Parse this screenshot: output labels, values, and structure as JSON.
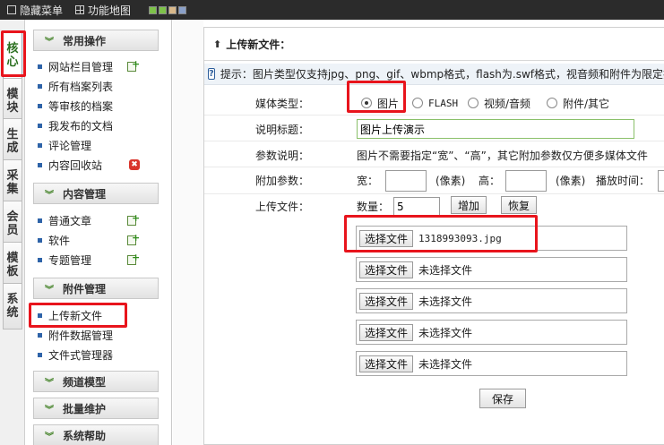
{
  "topbar": {
    "hide_menu": "隐藏菜单",
    "func_map": "功能地图",
    "swatches": [
      "#7ec24a",
      "#7ec24a",
      "#d8b88a",
      "#8aa0c8"
    ]
  },
  "vtabs": [
    {
      "line1": "核",
      "line2": "心"
    },
    {
      "line1": "模",
      "line2": "块"
    },
    {
      "line1": "生",
      "line2": "成"
    },
    {
      "line1": "采",
      "line2": "集"
    },
    {
      "line1": "会",
      "line2": "员"
    },
    {
      "line1": "模",
      "line2": "板"
    },
    {
      "line1": "系",
      "line2": "统"
    }
  ],
  "menu": {
    "common": {
      "title": "常用操作",
      "items": [
        "网站栏目管理",
        "所有档案列表",
        "等审核的档案",
        "我发布的文档",
        "评论管理",
        "内容回收站"
      ]
    },
    "content": {
      "title": "内容管理",
      "items": [
        "普通文章",
        "软件",
        "专题管理"
      ]
    },
    "attach": {
      "title": "附件管理",
      "items": [
        "上传新文件",
        "附件数据管理",
        "文件式管理器"
      ]
    },
    "channel": {
      "title": "频道模型"
    },
    "batch": {
      "title": "批量维护"
    },
    "help": {
      "title": "系统帮助"
    }
  },
  "main": {
    "title": "上传新文件：",
    "tip": "提示：图片类型仅支持jpg、png、gif、wbmp格式，flash为.swf格式，视音频和附件为限定扩",
    "media_label": "媒体类型：",
    "media_options": [
      "图片",
      "FLASH",
      "视频/音频",
      "附件/其它"
    ],
    "caption_label": "说明标题：",
    "caption_value": "图片上传演示",
    "param_label": "参数说明：",
    "param_text": "图片不需要指定“宽”、“高”，其它附加参数仅方便多媒体文件",
    "extra_label": "附加参数：",
    "width_label": "宽：",
    "width_unit": "(像素)",
    "height_label": "高：",
    "height_unit": "(像素)",
    "playtime_label": "播放时间：",
    "upload_label": "上传文件：",
    "count_label": "数量：",
    "count_value": "5",
    "add_button": "增加",
    "restore_button": "恢复",
    "choose_label": "选择文件",
    "files": [
      "1318993093.jpg",
      "未选择文件",
      "未选择文件",
      "未选择文件",
      "未选择文件"
    ],
    "save_button": "保存"
  }
}
